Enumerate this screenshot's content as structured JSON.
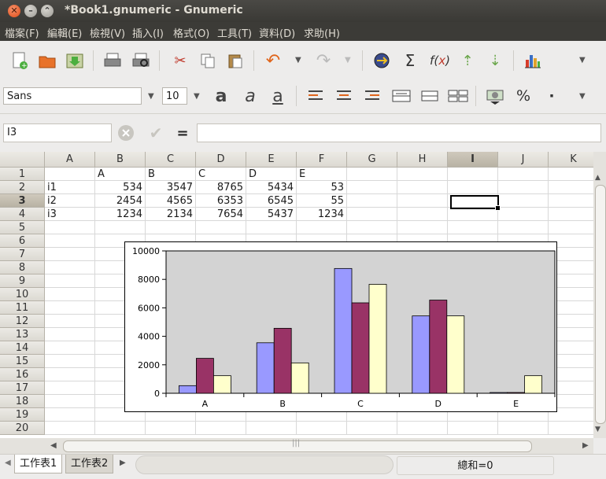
{
  "window": {
    "title": "*Book1.gnumeric - Gnumeric"
  },
  "menu": [
    "檔案(F)",
    "編輯(E)",
    "檢視(V)",
    "插入(I)",
    "格式(O)",
    "工具(T)",
    "資料(D)",
    "求助(H)"
  ],
  "format_toolbar": {
    "font": "Sans",
    "size": "10"
  },
  "formula_bar": {
    "cell_ref": "I3",
    "equals": "=",
    "content": ""
  },
  "columns": [
    "A",
    "B",
    "C",
    "D",
    "E",
    "F",
    "G",
    "H",
    "I",
    "J",
    "K"
  ],
  "rows": [
    "1",
    "2",
    "3",
    "4",
    "5",
    "6",
    "7",
    "8",
    "9",
    "10",
    "11",
    "12",
    "13",
    "14",
    "15",
    "16",
    "17",
    "18",
    "19",
    "20"
  ],
  "selected": {
    "col": "I",
    "row": "3"
  },
  "cells": [
    [
      "",
      "A",
      "B",
      "C",
      "D",
      "E"
    ],
    [
      "i1",
      "534",
      "3547",
      "8765",
      "5434",
      "53"
    ],
    [
      "i2",
      "2454",
      "4565",
      "6353",
      "6545",
      "55"
    ],
    [
      "i3",
      "1234",
      "2134",
      "7654",
      "5437",
      "1234"
    ]
  ],
  "sheets": [
    "工作表1",
    "工作表2"
  ],
  "status": {
    "sum": "總和=0"
  },
  "chart_data": {
    "type": "bar",
    "categories": [
      "A",
      "B",
      "C",
      "D",
      "E"
    ],
    "series": [
      {
        "values": [
          534,
          3547,
          8765,
          5434,
          53
        ],
        "color": "#9999ff"
      },
      {
        "values": [
          2454,
          4565,
          6353,
          6545,
          55
        ],
        "color": "#993366"
      },
      {
        "values": [
          1234,
          2134,
          7654,
          5437,
          1234
        ],
        "color": "#ffffcc"
      }
    ],
    "ylim": [
      0,
      10000
    ],
    "yticks": [
      "0",
      "2000",
      "4000",
      "6000",
      "8000",
      "10000"
    ],
    "plot_background": "#d3d3d3",
    "grid": false
  }
}
